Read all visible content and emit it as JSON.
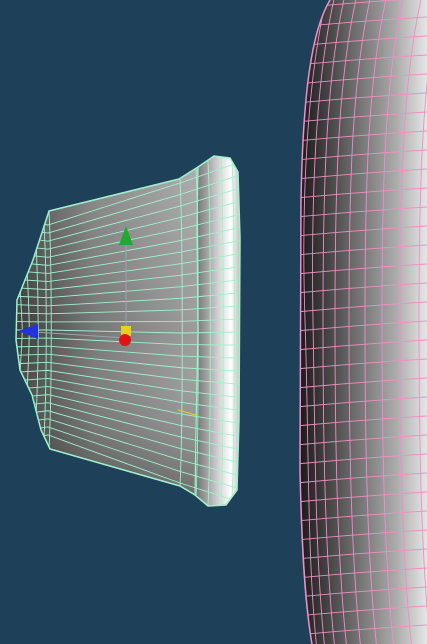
{
  "viewport": {
    "background": "#1e4059"
  },
  "objects": [
    {
      "id": "selected-bell-mesh",
      "selected": true,
      "wireframe_color": "#9ff2cc",
      "shading": "grey-gradient"
    },
    {
      "id": "large-capsule-mesh",
      "selected": false,
      "wireframe_color": "#f08fc4",
      "shading": "grey-gradient"
    }
  ],
  "gizmo": {
    "type": "translate",
    "axes": [
      {
        "axis": "y",
        "color": "#1fa832",
        "icon": "arrow-up-icon"
      },
      {
        "axis": "x",
        "color": "#2233dd",
        "icon": "arrow-left-icon"
      },
      {
        "axis": "z",
        "color": "#e01414",
        "icon": "sphere-handle-icon"
      }
    ],
    "center_color": "#e6d21c"
  }
}
